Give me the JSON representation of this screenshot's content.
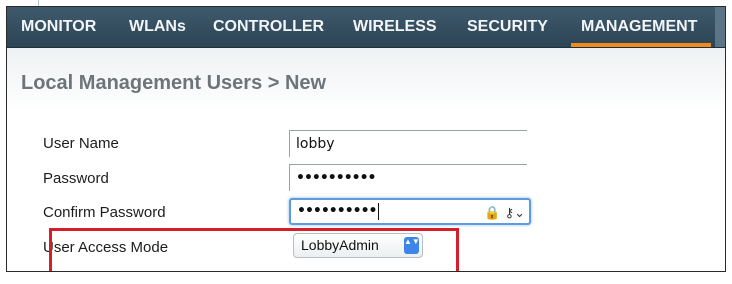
{
  "nav": {
    "items": [
      {
        "label": "MONITOR"
      },
      {
        "label": "WLANs"
      },
      {
        "label": "CONTROLLER"
      },
      {
        "label": "WIRELESS"
      },
      {
        "label": "SECURITY"
      },
      {
        "label": "MANAGEMENT",
        "active": true
      }
    ],
    "active_color": "#f08a1c"
  },
  "page": {
    "title": "Local Management Users > New"
  },
  "form": {
    "user_name": {
      "label": "User Name",
      "value": "lobby"
    },
    "password": {
      "label": "Password",
      "value": "••••••••••"
    },
    "confirm_password": {
      "label": "Confirm Password",
      "value": "••••••••••",
      "icons": "🔒 ⚷⌄"
    },
    "access_mode": {
      "label": "User Access Mode",
      "value": "LobbyAdmin",
      "arrows": "▲▼"
    }
  },
  "colors": {
    "navbar": "#2b4456",
    "highlight": "#d61e28",
    "focus": "#5f9be3",
    "select_arrow": "#3b86e8"
  }
}
